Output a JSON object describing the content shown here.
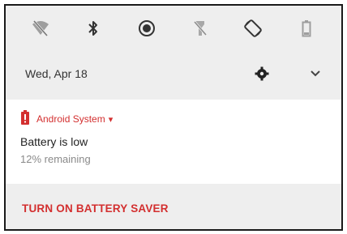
{
  "quick_settings": {
    "tiles": [
      {
        "icon": "wifi-off-icon"
      },
      {
        "icon": "bluetooth-icon"
      },
      {
        "icon": "do-not-disturb-icon"
      },
      {
        "icon": "flashlight-off-icon"
      },
      {
        "icon": "auto-rotate-icon"
      },
      {
        "icon": "battery-icon"
      }
    ]
  },
  "header": {
    "date": "Wed, Apr 18",
    "settings_icon": "gear-icon",
    "expand_icon": "chevron-down-icon"
  },
  "notification": {
    "app_icon": "battery-alert-icon",
    "app_name": "Android System",
    "app_chevron": "▾",
    "title": "Battery is low",
    "text": "12% remaining",
    "accent_color": "#d32f2f"
  },
  "actions": {
    "battery_saver": "TURN ON BATTERY SAVER"
  }
}
